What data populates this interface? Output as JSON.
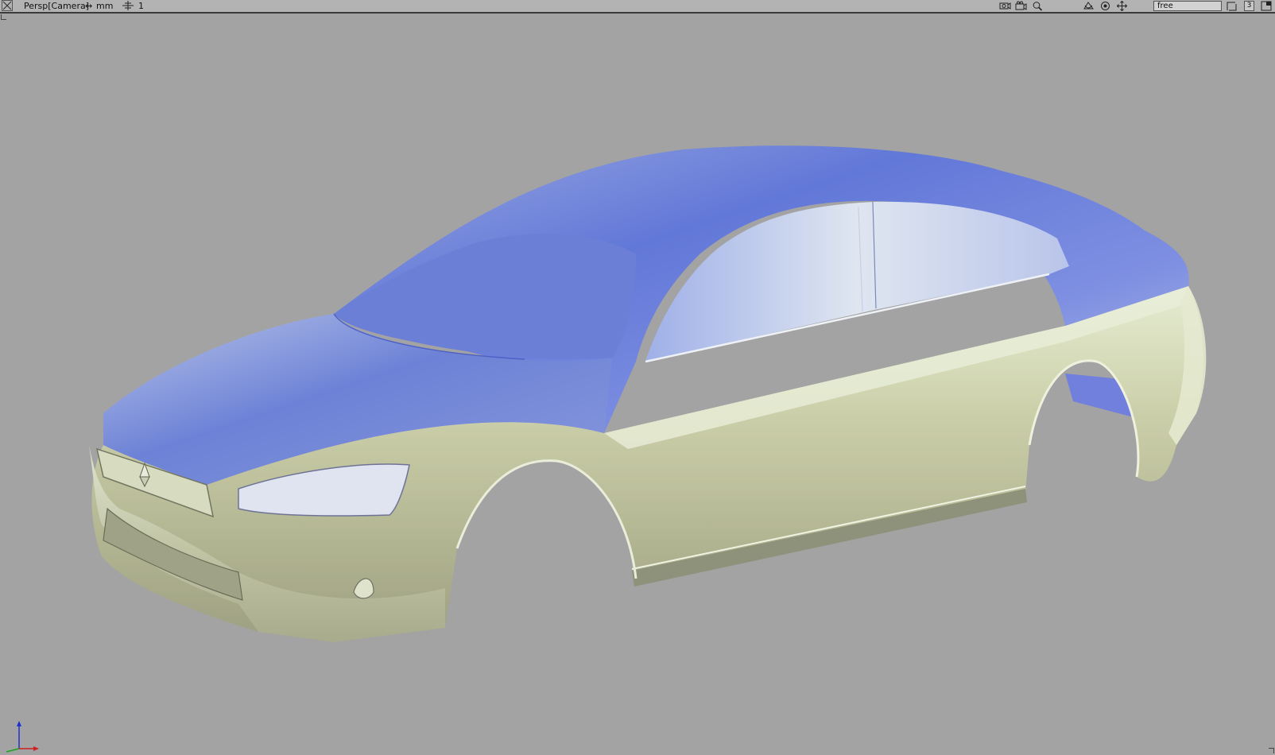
{
  "viewport": {
    "camera_label": "Persp[Camera]",
    "units_label": "mm",
    "grid_label": "1",
    "display_mode": "free",
    "layer_number": "3",
    "background_color": "#a3a3a3"
  },
  "toolbar": {
    "icons": [
      "camera-icon",
      "video-camera-icon",
      "zoom-icon",
      "tumble-icon",
      "dolly-icon",
      "pan-icon",
      "maximize-icon",
      "window-icon"
    ]
  },
  "axis": {
    "x_color": "#d02020",
    "y_color": "#20a020",
    "z_color": "#2030d0"
  },
  "model": {
    "body_highlight_color": "#6b84d8",
    "body_side_color": "#c8cca4"
  }
}
